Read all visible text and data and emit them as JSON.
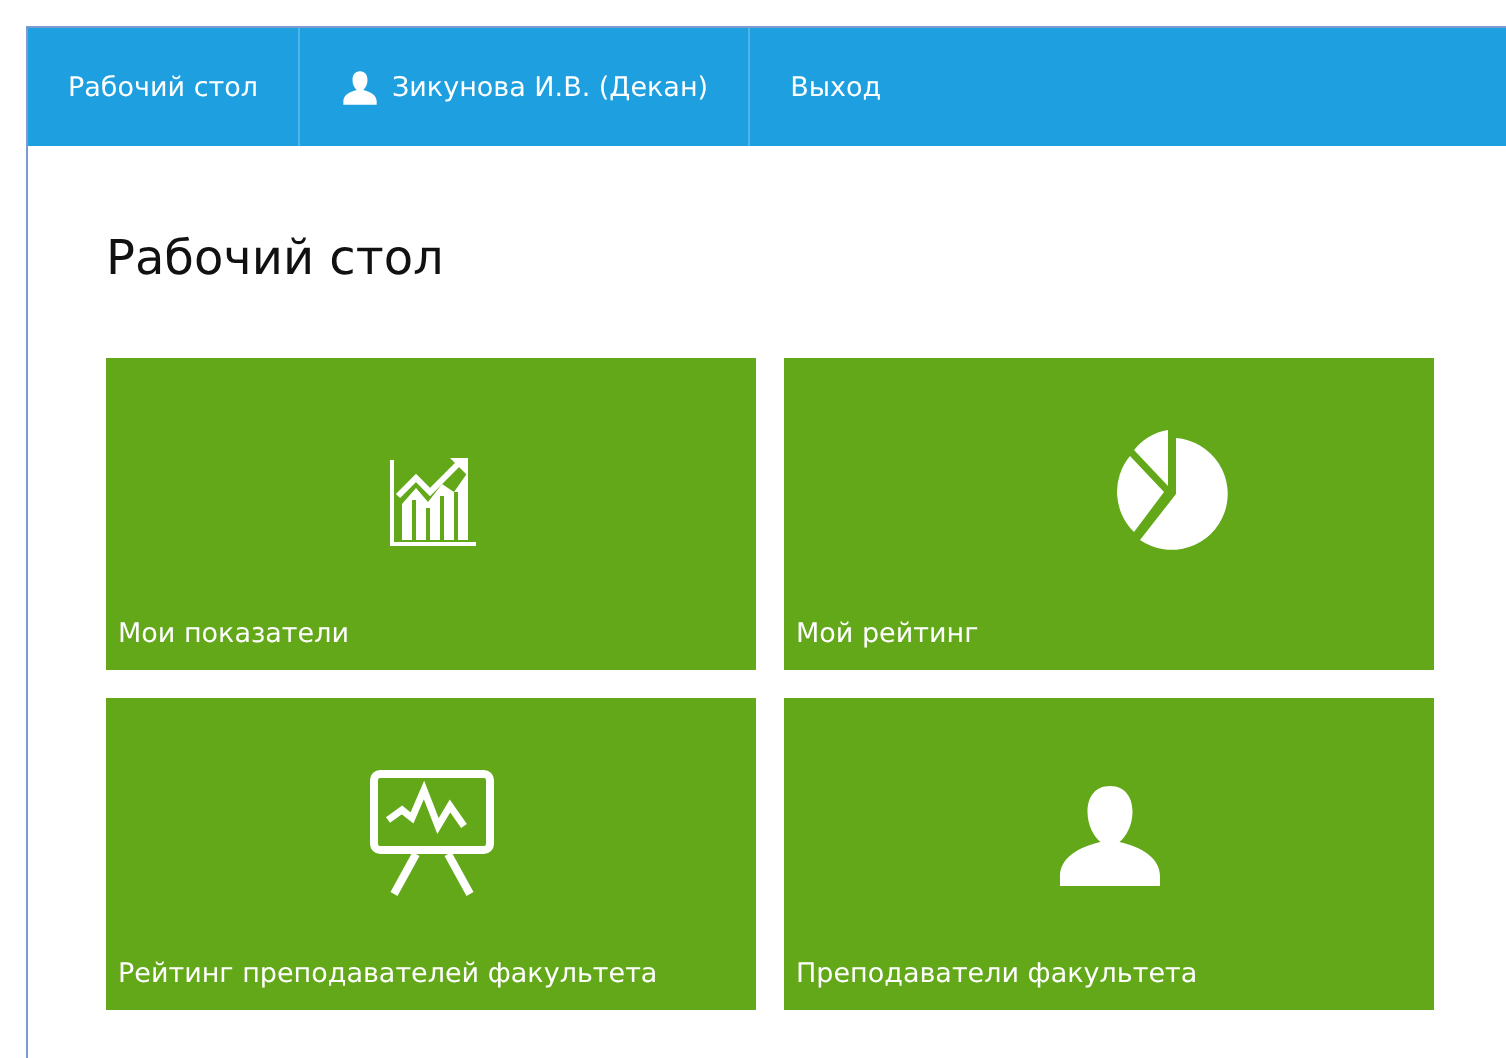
{
  "navbar": {
    "items": [
      {
        "kind": "link",
        "label": "Рабочий стол"
      },
      {
        "kind": "user",
        "label": "Зикунова И.В. (Декан)"
      },
      {
        "kind": "link",
        "label": "Выход"
      }
    ]
  },
  "page_title": "Рабочий стол",
  "tiles": [
    {
      "kind": "chart",
      "label": "Мои показатели"
    },
    {
      "kind": "pie",
      "label": "Мой рейтинг"
    },
    {
      "kind": "board",
      "label": "Рейтинг преподавателей факультета"
    },
    {
      "kind": "person",
      "label": "Преподаватели факультета"
    }
  ]
}
